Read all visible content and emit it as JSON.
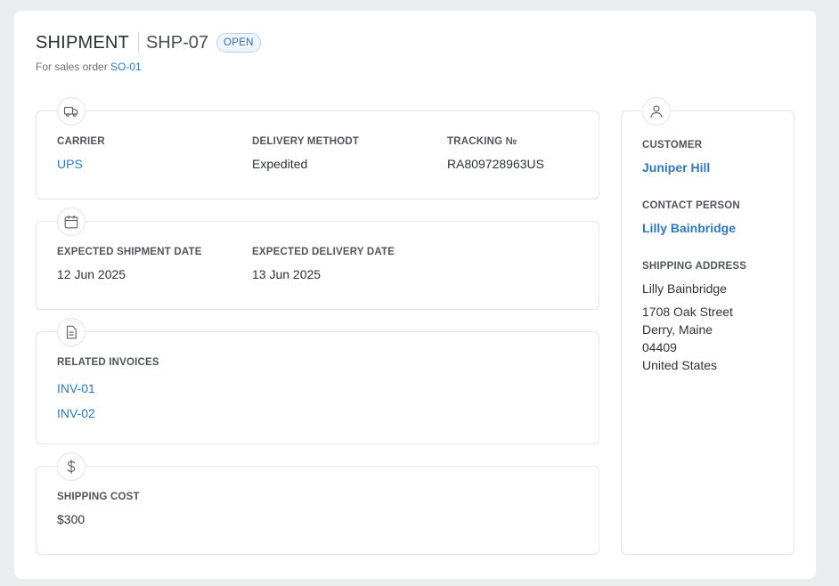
{
  "header": {
    "doc_type": "SHIPMENT",
    "doc_id": "SHP-07",
    "status": "OPEN",
    "subline_prefix": "For sales order",
    "sales_order": "SO-01"
  },
  "shipping_card": {
    "icon": "truck-icon",
    "carrier_label": "CARRIER",
    "carrier_value": "UPS",
    "method_label": "DELIVERY METHODT",
    "method_value": "Expedited",
    "tracking_label": "TRACKING №",
    "tracking_value": "RA809728963US"
  },
  "dates_card": {
    "icon": "calendar-icon",
    "ship_date_label": "EXPECTED SHIPMENT DATE",
    "ship_date_value": "12 Jun 2025",
    "delivery_date_label": "EXPECTED DELIVERY DATE",
    "delivery_date_value": "13 Jun 2025"
  },
  "invoices_card": {
    "icon": "document-icon",
    "label": "RELATED INVOICES",
    "invoices": [
      "INV-01",
      "INV-02"
    ]
  },
  "cost_card": {
    "icon": "dollar-icon",
    "label": "SHIPPING COST",
    "value": "$300"
  },
  "customer_card": {
    "icon": "user-icon",
    "customer_label": "CUSTOMER",
    "customer_value": "Juniper Hill",
    "contact_label": "CONTACT PERSON",
    "contact_value": "Lilly Bainbridge",
    "address_label": "SHIPPING ADDRESS",
    "address_name": "Lilly Bainbridge",
    "address_lines": [
      "1708 Oak Street",
      "Derry, Maine",
      "04409",
      "United States"
    ]
  },
  "colors": {
    "accent_link": "#2f78bd",
    "badge_border": "#b9d2ec",
    "background": "#ebecee"
  }
}
